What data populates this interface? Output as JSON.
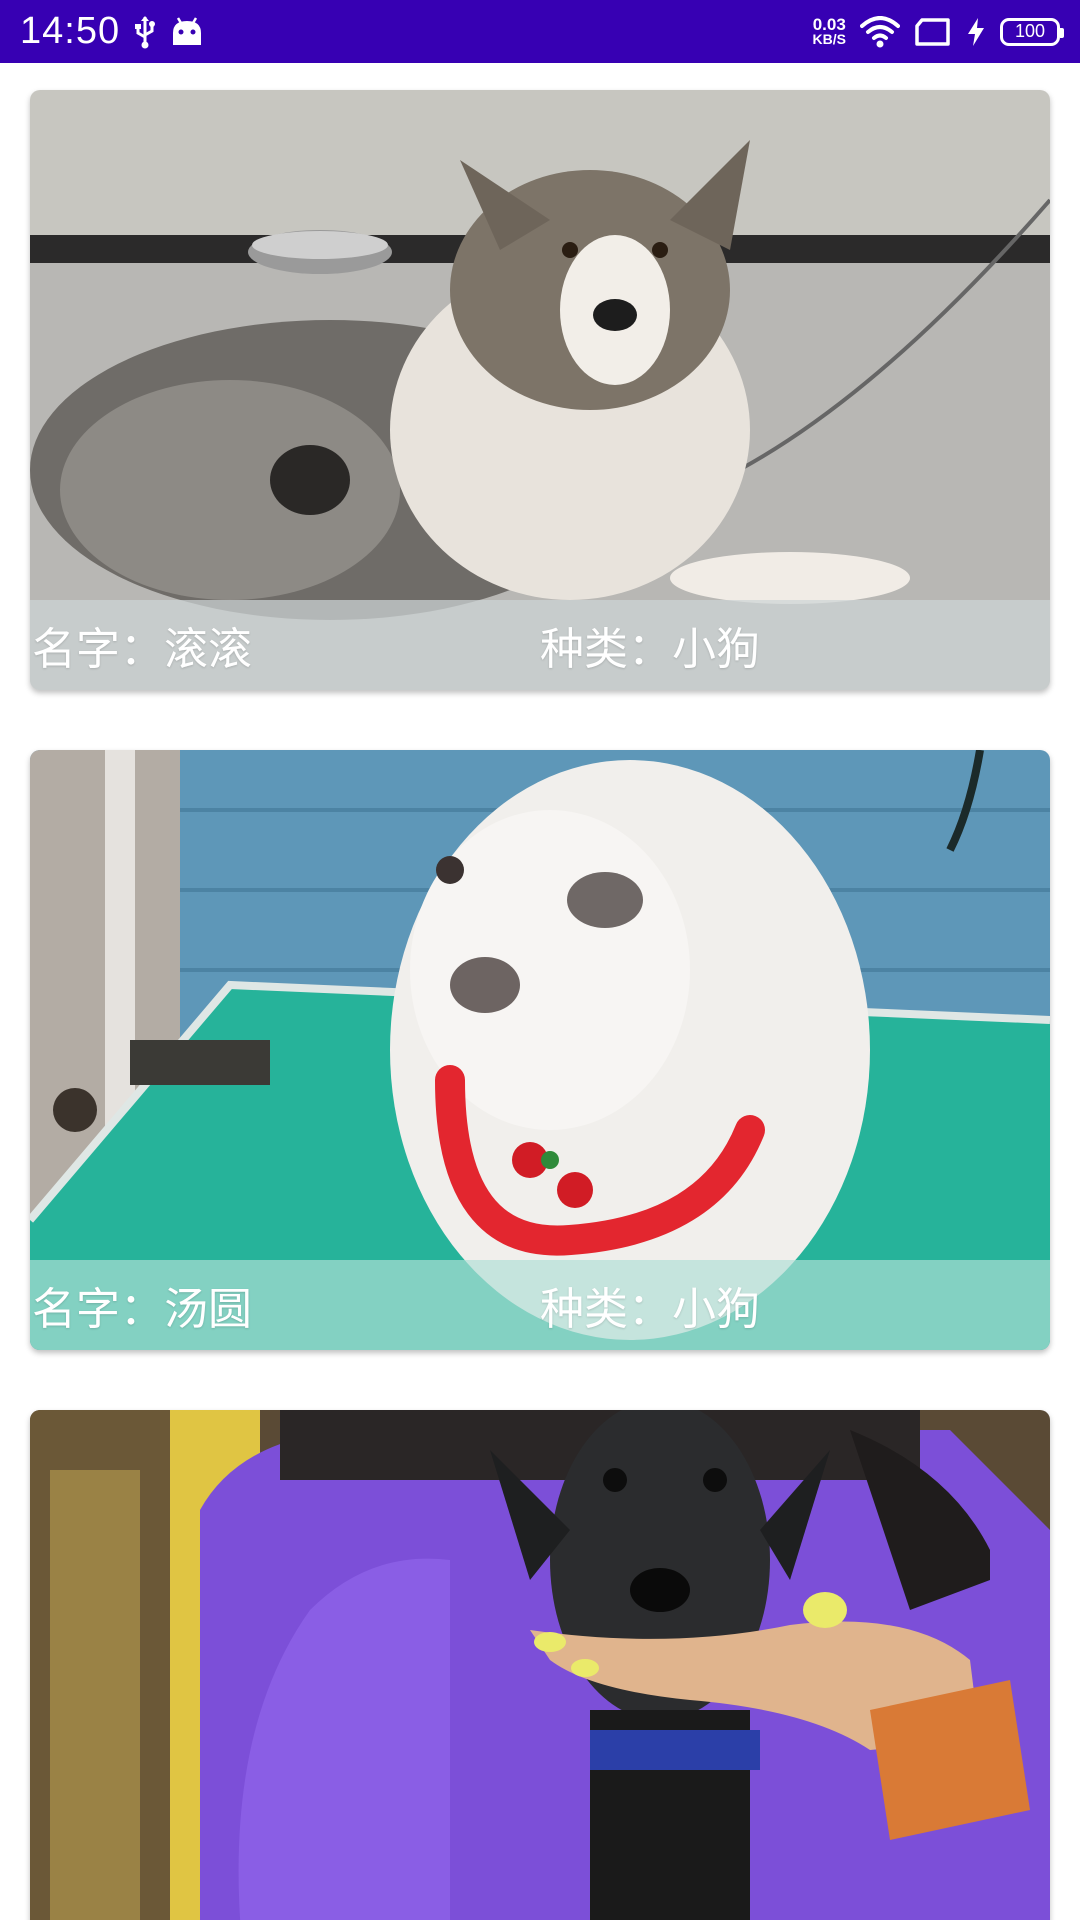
{
  "status_bar": {
    "time": "14:50",
    "net_speed_value": "0.03",
    "net_speed_unit": "KB/S",
    "battery": "100",
    "background": "#3700b3"
  },
  "pets": [
    {
      "name_label": "名字：滚滚",
      "kind_label": "种类：小狗",
      "photo_icon": "merle-shepherd-dog-photo",
      "caption_tint": "#c9cfd0"
    },
    {
      "name_label": "名字：汤圆",
      "kind_label": "种类：小狗",
      "photo_icon": "white-pomeranian-photo",
      "caption_tint": "#9fd6cc"
    },
    {
      "name_label": "",
      "kind_label": "",
      "photo_icon": "black-puppy-held-photo",
      "caption_tint": ""
    }
  ]
}
